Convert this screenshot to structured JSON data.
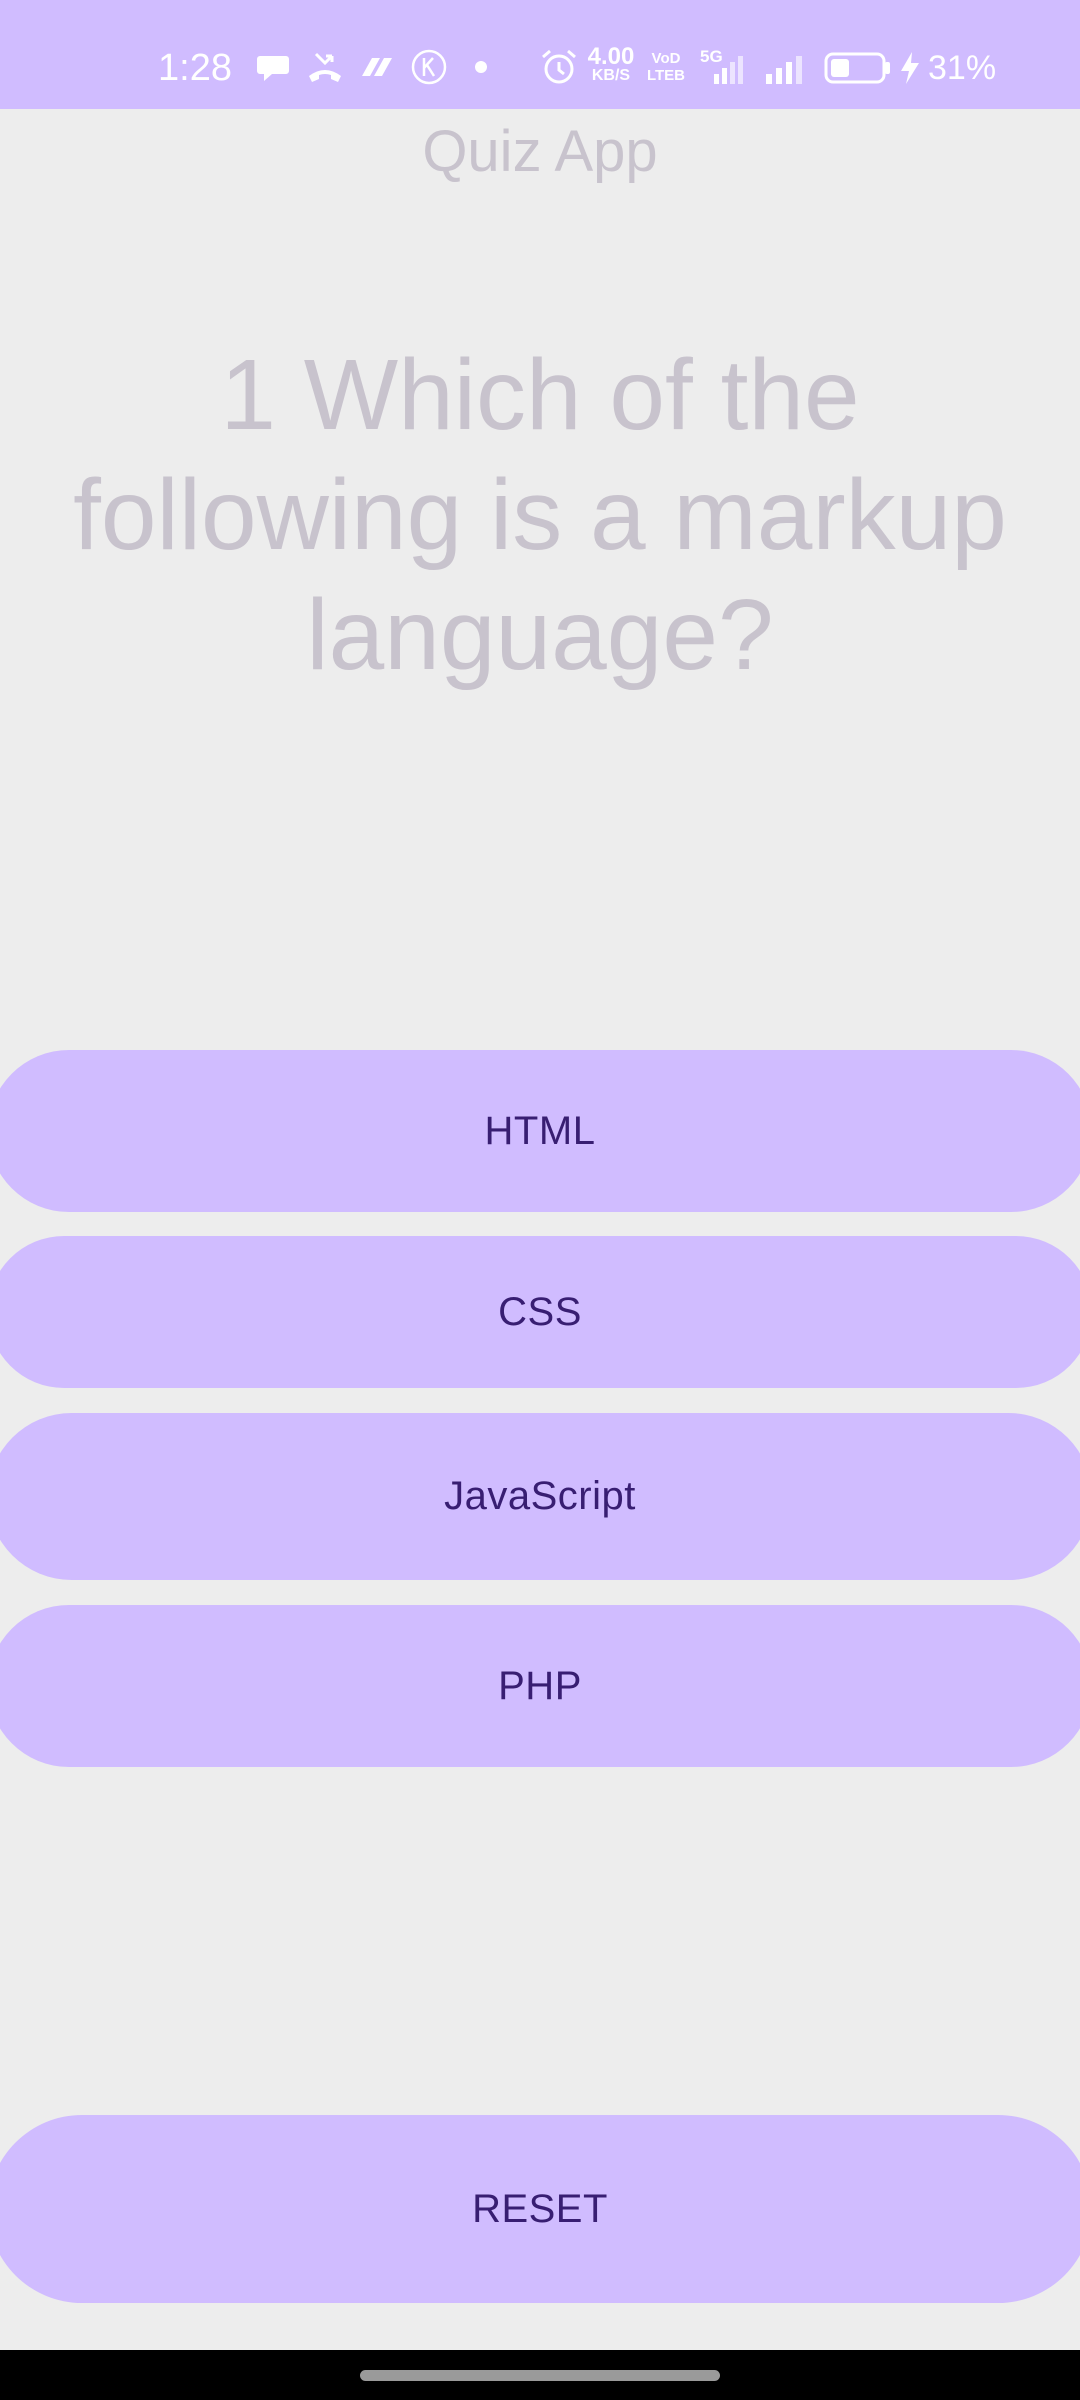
{
  "status_bar": {
    "time": "1:28",
    "net_speed_value": "4.00",
    "net_speed_unit": "KB/S",
    "volte_top": "VoD",
    "volte_bottom": "LTEB",
    "network_type": "5G",
    "battery_percent": "31%",
    "icons": [
      "chat-bubble-icon",
      "missed-call-icon",
      "payment-app-icon",
      "k-app-icon",
      "dot-icon",
      "alarm-icon",
      "signal-icon",
      "signal-icon",
      "battery-icon",
      "charging-icon"
    ],
    "color": "#d0bcff"
  },
  "app": {
    "title": "Quiz App"
  },
  "question": {
    "text": "1 Which of the following is a markup language?"
  },
  "answers": [
    "HTML",
    "CSS",
    "JavaScript",
    "PHP"
  ],
  "reset_label": "RESET",
  "colors": {
    "accent": "#d0bcff",
    "button_text": "#381e72",
    "background": "#ededed",
    "muted_text": "#c8c3cd"
  }
}
